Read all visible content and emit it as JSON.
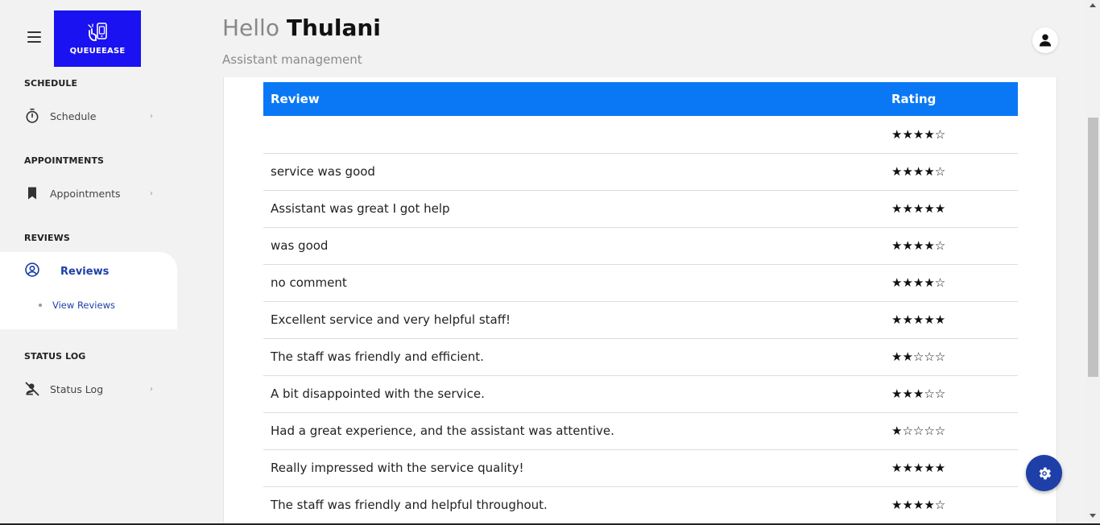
{
  "app": {
    "logo_text": "QUEUEEASE"
  },
  "header": {
    "hello": "Hello",
    "name": "Thulani",
    "subtitle": "Assistant management"
  },
  "sidebar": {
    "sections": {
      "schedule": {
        "title": "SCHEDULE",
        "item": "Schedule"
      },
      "appointments": {
        "title": "APPOINTMENTS",
        "item": "Appointments"
      },
      "reviews": {
        "title": "REVIEWS",
        "item": "Reviews",
        "sub_item": "View Reviews"
      },
      "status_log": {
        "title": "STATUS LOG",
        "item": "Status Log"
      }
    }
  },
  "table": {
    "headers": {
      "review": "Review",
      "rating": "Rating"
    },
    "rows": [
      {
        "review": "",
        "rating": "★★★★☆"
      },
      {
        "review": "service was good",
        "rating": "★★★★☆"
      },
      {
        "review": "Assistant was great I got help",
        "rating": "★★★★★"
      },
      {
        "review": "was good",
        "rating": "★★★★☆"
      },
      {
        "review": "no comment",
        "rating": "★★★★☆"
      },
      {
        "review": "Excellent service and very helpful staff!",
        "rating": "★★★★★"
      },
      {
        "review": "The staff was friendly and efficient.",
        "rating": "★★☆☆☆"
      },
      {
        "review": "A bit disappointed with the service.",
        "rating": "★★★☆☆"
      },
      {
        "review": "Had a great experience, and the assistant was attentive.",
        "rating": "★☆☆☆☆"
      },
      {
        "review": "Really impressed with the service quality!",
        "rating": "★★★★★"
      },
      {
        "review": "The staff was friendly and helpful throughout.",
        "rating": "★★★★☆"
      }
    ]
  },
  "colors": {
    "brand": "#1a12f0",
    "accent": "#1e3fa8",
    "table_header": "#0a78f5"
  },
  "icons": {
    "menu": "hamburger-icon",
    "schedule": "stopwatch-icon",
    "appointments": "bookmark-icon",
    "reviews": "user-circle-icon",
    "status_log": "user-off-icon",
    "profile": "user-icon",
    "settings": "gear-icon"
  }
}
